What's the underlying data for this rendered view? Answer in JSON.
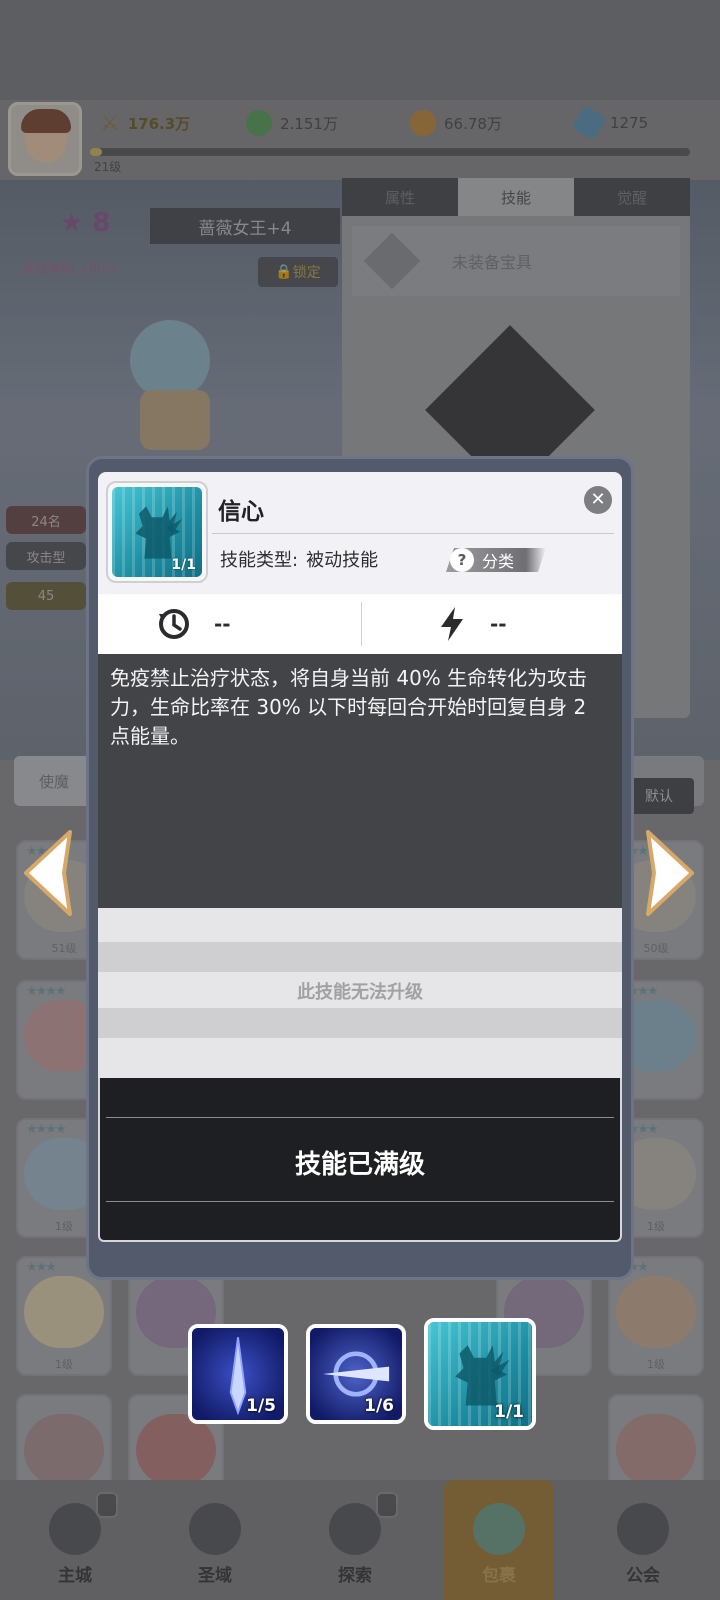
{
  "top": {
    "level_label": "21级",
    "power": "176.3万",
    "resources": [
      {
        "icon": "green-orb-icon",
        "value": "2.151万"
      },
      {
        "icon": "gold-coin-icon",
        "value": "66.78万"
      },
      {
        "icon": "blue-crystal-icon",
        "value": "1275"
      }
    ]
  },
  "hero": {
    "star_count": "8",
    "name": "蔷薇女王+4",
    "lock_label": "锁定",
    "buff_label": "星级增幅 +80%"
  },
  "side": {
    "rank_label": "24名",
    "role_label": "攻击型",
    "power_short": "45"
  },
  "panel": {
    "tabs": [
      "属性",
      "技能",
      "觉醒"
    ],
    "treasure_label": "未装备宝具"
  },
  "filter": {
    "left_label": "使魔",
    "right_label": "默认"
  },
  "dialog": {
    "skill_name": "信心",
    "skill_count": "1/1",
    "type_label": "技能类型:",
    "type_value": "被动技能",
    "category_q": "?",
    "category_label": "分类",
    "cooldown_value": "--",
    "energy_value": "--",
    "description": "免疫禁止治疗状态，将自身当前 40% 生命转化为攻击力，生命比率在 30% 以下时每回合开始时回复自身 2 点能量。",
    "upgrade_note": "此技能无法升级",
    "maxed_label": "技能已满级",
    "close_symbol": "✕"
  },
  "skills": [
    {
      "count": "1/5"
    },
    {
      "count": "1/6"
    },
    {
      "count": "1/1"
    }
  ],
  "card_levels": [
    "51级",
    "50级",
    "1级",
    "1级",
    "1级",
    "1级"
  ],
  "tabbar": [
    "主城",
    "圣域",
    "探索",
    "包裹",
    "公会"
  ],
  "colors": {
    "accent_teal": "#1d8da1",
    "dialog_frame": "#535a6b",
    "desc_bg": "#434447",
    "maxed_bg": "#1e1f22"
  }
}
